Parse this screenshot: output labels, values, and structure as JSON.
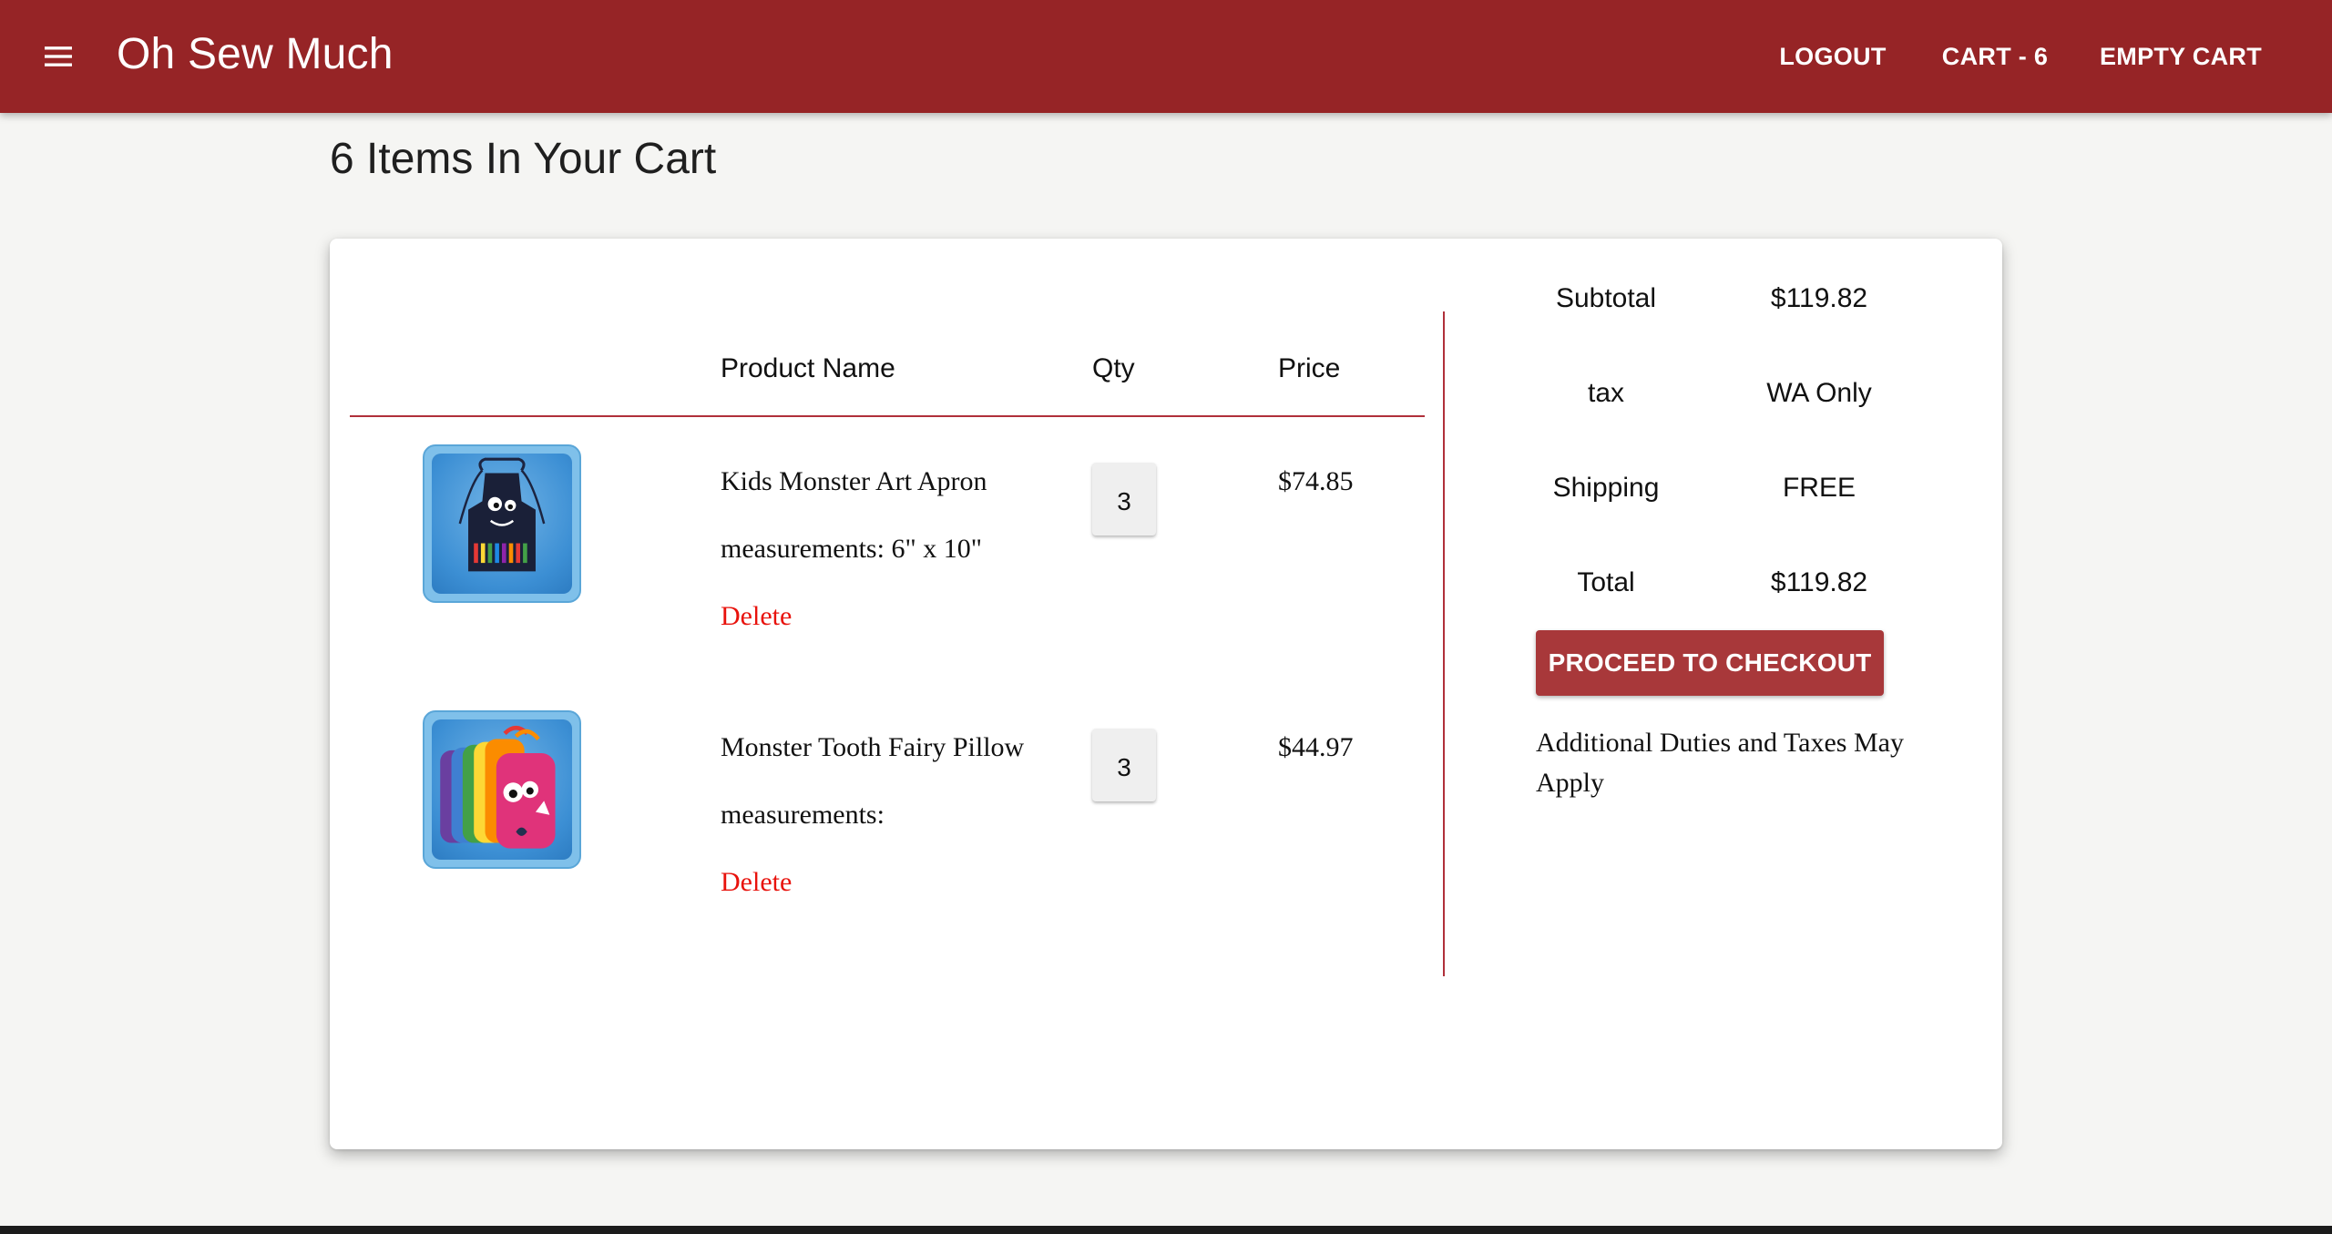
{
  "app": {
    "title": "Oh Sew Much",
    "menu_icon": "hamburger-menu-icon",
    "brand_color": "#962426",
    "nav": {
      "logout": "LOGOUT",
      "cart": "CART - 6",
      "empty_cart": "EMPTY CART"
    }
  },
  "page": {
    "heading": "6 Items In Your Cart"
  },
  "table": {
    "headers": {
      "product_name": "Product Name",
      "qty": "Qty",
      "price": "Price"
    },
    "items": [
      {
        "name": "Kids Monster Art Apron",
        "measurements": "measurements: 6\" x 10\"",
        "qty": "3",
        "price": "$74.85",
        "delete_label": "Delete",
        "image_icon": "apron-product-image"
      },
      {
        "name": "Monster Tooth Fairy Pillow",
        "measurements": "measurements:",
        "qty": "3",
        "price": "$44.97",
        "delete_label": "Delete",
        "image_icon": "pillow-product-image"
      }
    ]
  },
  "summary": {
    "subtotal_label": "Subtotal",
    "subtotal_value": "$119.82",
    "tax_label": "tax",
    "tax_value": "WA Only",
    "shipping_label": "Shipping",
    "shipping_value": "FREE",
    "total_label": "Total",
    "total_value": "$119.82",
    "checkout_label": "PROCEED TO CHECKOUT",
    "duties_note": "Additional Duties and Taxes May Apply"
  },
  "colors": {
    "accent": "#962426",
    "button": "#a8383a",
    "delete_link": "#e8120c",
    "divider": "#b0303a"
  }
}
